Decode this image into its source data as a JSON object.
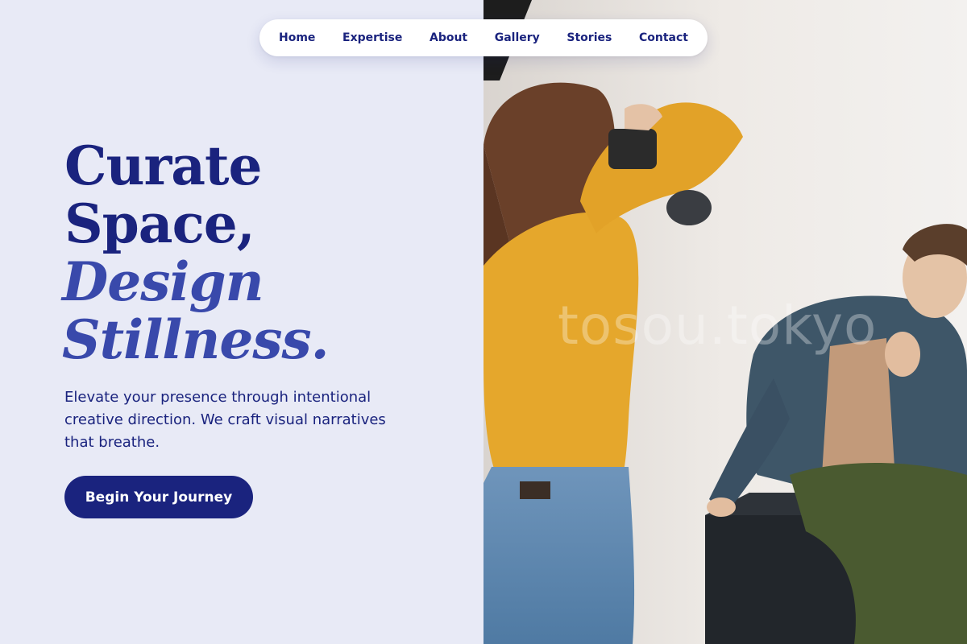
{
  "nav": {
    "items": [
      "Home",
      "Expertise",
      "About",
      "Gallery",
      "Stories",
      "Contact"
    ]
  },
  "hero": {
    "title_line_1": "Curate",
    "title_line_2": "Space,",
    "title_line_3": "Design",
    "title_line_4": "Stillness.",
    "subtitle": "Elevate your presence through intentional creative direction. We craft visual narratives that breathe.",
    "cta_label": "Begin Your Journey"
  },
  "photo": {
    "watermark": "tosou.tokyo"
  },
  "colors": {
    "background": "#e8eaf6",
    "primary": "#1a237e",
    "accent": "#3949ab",
    "nav_bg": "#ffffff"
  }
}
